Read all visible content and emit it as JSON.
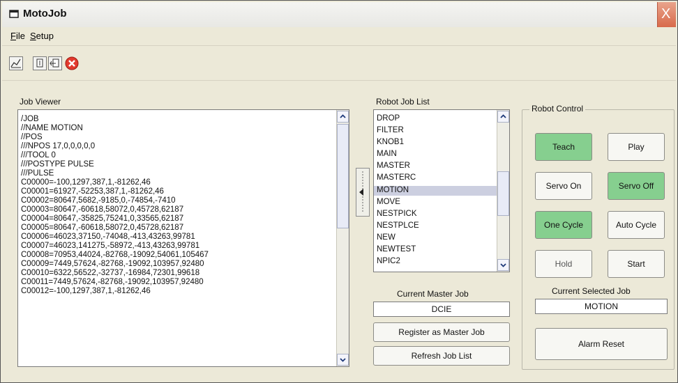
{
  "window": {
    "title": "MotoJob",
    "close_glyph": "X"
  },
  "menu": {
    "file": {
      "mnemonic": "F",
      "rest": "ile"
    },
    "setup": {
      "mnemonic": "S",
      "rest": "etup"
    }
  },
  "toolbar": {
    "icons": [
      "chart-icon",
      "document-icon",
      "job-edit-icon",
      "stop-icon"
    ]
  },
  "job_viewer": {
    "label": "Job Viewer",
    "lines": [
      "/JOB",
      "//NAME MOTION",
      "//POS",
      "///NPOS 17,0,0,0,0,0",
      "///TOOL 0",
      "///POSTYPE PULSE",
      "///PULSE",
      "C00000=-100,1297,387,1,-81262,46",
      "C00001=61927,-52253,387,1,-81262,46",
      "C00002=80647,5682,-9185,0,-74854,-7410",
      "C00003=80647,-60618,58072,0,45728,62187",
      "C00004=80647,-35825,75241,0,33565,62187",
      "C00005=80647,-60618,58072,0,45728,62187",
      "C00006=46023,37150,-74048,-413,43263,99781",
      "C00007=46023,141275,-58972,-413,43263,99781",
      "C00008=70953,44024,-82768,-19092,54061,105467",
      "C00009=7449,57624,-82768,-19092,103957,92480",
      "C00010=6322,56522,-32737,-16984,72301,99618",
      "C00011=7449,57624,-82768,-19092,103957,92480",
      "C00012=-100,1297,387,1,-81262,46"
    ]
  },
  "robot_job_list": {
    "label": "Robot Job List",
    "items": [
      "DROP",
      "FILTER",
      "KNOB1",
      "MAIN",
      "MASTER",
      "MASTERC",
      "MOTION",
      "MOVE",
      "NESTPICK",
      "NESTPLCE",
      "NEW",
      "NEWTEST",
      "NPIC2"
    ],
    "selected": "MOTION"
  },
  "master": {
    "label": "Current Master Job",
    "value": "DCIE",
    "register_button": "Register as Master Job",
    "refresh_button": "Refresh Job List"
  },
  "robot_control": {
    "title": "Robot Control",
    "teach": "Teach",
    "play": "Play",
    "servo_on": "Servo On",
    "servo_off": "Servo Off",
    "one_cycle": "One Cycle",
    "auto_cycle": "Auto Cycle",
    "hold": "Hold",
    "start": "Start",
    "selected_label": "Current Selected Job",
    "selected_value": "MOTION",
    "alarm_reset": "Alarm Reset"
  },
  "colors": {
    "active_button": "#86cf8f",
    "window_bg": "#ece9d8",
    "selection": "#cccfe0",
    "close_button": "#d86a4b"
  }
}
